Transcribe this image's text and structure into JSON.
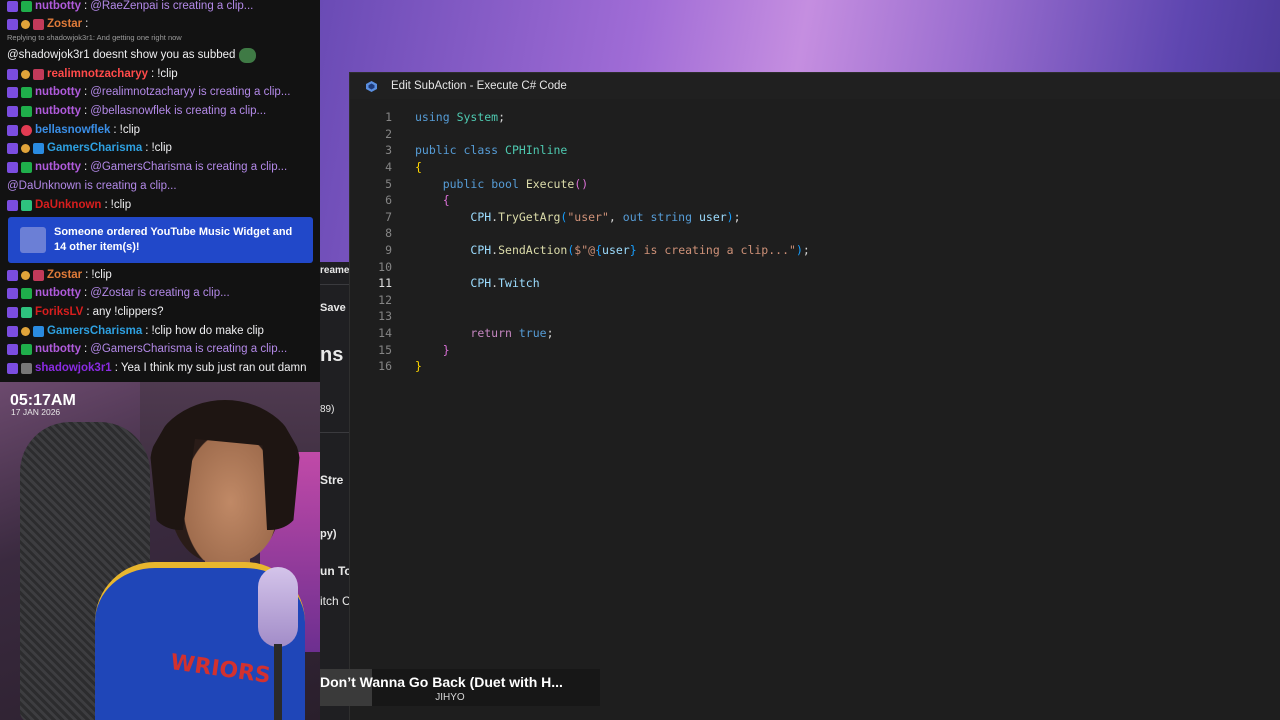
{
  "editor": {
    "title": "Edit SubAction - Execute C# Code",
    "active_line": 11,
    "lines": [
      "using System;",
      "",
      "public class CPHInline",
      "{",
      "    public bool Execute()",
      "    {",
      "        CPH.TryGetArg(\"user\", out string user);",
      "",
      "        CPH.SendAction($\"@{user} is creating a clip...\");",
      "",
      "        CPH.Twitch",
      "",
      "",
      "        return true;",
      "    }",
      "}"
    ]
  },
  "background_app": {
    "fragments": [
      "reame",
      "Save",
      "ns",
      "89)",
      "Stre",
      "py)",
      "un To",
      "itch C"
    ]
  },
  "chat": {
    "reply_note": "Replying to shadowjok3r1: And getting one right now",
    "messages": [
      {
        "badges": [
          "mod",
          "check"
        ],
        "user": "nutbotty",
        "color": "#b05bdc",
        "text": "@RaeZenpai is creating a clip...",
        "text_style": "purple"
      },
      {
        "badges": [
          "mod",
          "crown",
          "sub"
        ],
        "user": "Zostar",
        "color": "#e07b39",
        "text": "",
        "text_style": "normal"
      },
      {
        "badges": [],
        "user": "",
        "color": "#efeff1",
        "text": "@shadowjok3r1 doesnt show you as subbed",
        "text_style": "normal",
        "emote": "green-emote"
      },
      {
        "badges": [
          "mod",
          "crown",
          "sub"
        ],
        "user": "realimnotzacharyy",
        "color": "#ff4a4a",
        "text": "!clip",
        "text_style": "normal"
      },
      {
        "badges": [
          "mod",
          "check"
        ],
        "user": "nutbotty",
        "color": "#b05bdc",
        "text": "@realimnotzacharyy is creating a clip...",
        "text_style": "purple"
      },
      {
        "badges": [
          "mod",
          "check"
        ],
        "user": "nutbotty",
        "color": "#b05bdc",
        "text": "@bellasnowflek is creating a clip...",
        "text_style": "purple"
      },
      {
        "badges": [
          "mod",
          "heart"
        ],
        "user": "bellasnowflek",
        "color": "#3a8ee6",
        "text": "!clip",
        "text_style": "normal"
      },
      {
        "badges": [
          "mod",
          "crown",
          "prime"
        ],
        "user": "GamersCharisma",
        "color": "#2ea0e0",
        "text": "!clip",
        "text_style": "normal"
      },
      {
        "badges": [
          "mod",
          "check"
        ],
        "user": "nutbotty",
        "color": "#b05bdc",
        "text": "@GamersCharisma is creating a clip...",
        "text_style": "purple"
      },
      {
        "badges": [],
        "user": "",
        "color": "#b389e8",
        "text": "@DaUnknown is creating a clip...",
        "text_style": "purple"
      },
      {
        "badges": [
          "mod",
          "green"
        ],
        "user": "DaUnknown",
        "color": "#d81e1e",
        "text": "!clip",
        "text_style": "normal"
      },
      {
        "badges": [
          "mod",
          "crown",
          "sub"
        ],
        "user": "Zostar",
        "color": "#e07b39",
        "text": "!clip",
        "text_style": "normal"
      },
      {
        "badges": [
          "mod",
          "check"
        ],
        "user": "nutbotty",
        "color": "#b05bdc",
        "text": "@Zostar is creating a clip...",
        "text_style": "purple"
      },
      {
        "badges": [
          "mod",
          "green"
        ],
        "user": "ForiksLV",
        "color": "#d81e1e",
        "text": "any !clippers?",
        "text_style": "normal"
      },
      {
        "badges": [
          "mod",
          "crown",
          "prime"
        ],
        "user": "GamersCharisma",
        "color": "#2ea0e0",
        "text": "!clip how do make clip",
        "text_style": "normal"
      },
      {
        "badges": [
          "mod",
          "check"
        ],
        "user": "nutbotty",
        "color": "#b05bdc",
        "text": "@GamersCharisma is creating a clip...",
        "text_style": "purple"
      },
      {
        "badges": [
          "mod",
          "gray"
        ],
        "user": "shadowjok3r1",
        "color": "#8a2be2",
        "text": "Yea I think my sub just ran out damn",
        "text_style": "normal"
      }
    ],
    "order_card": {
      "line1": "Someone ordered YouTube Music Widget and",
      "line2": "14 other item(s)!"
    }
  },
  "webcam": {
    "time": "05:17AM",
    "date": "17 JAN 2026",
    "jersey_text": "WRIORS"
  },
  "now_playing": {
    "title": "Don’t Wanna Go Back (Duet with H...",
    "artist": "JIHYO"
  },
  "colors": {
    "editor_bg": "#1e1e1e",
    "chat_bg": "#121212",
    "order_card": "#2148c9",
    "wallpaper_accent": "#a06cd6"
  }
}
